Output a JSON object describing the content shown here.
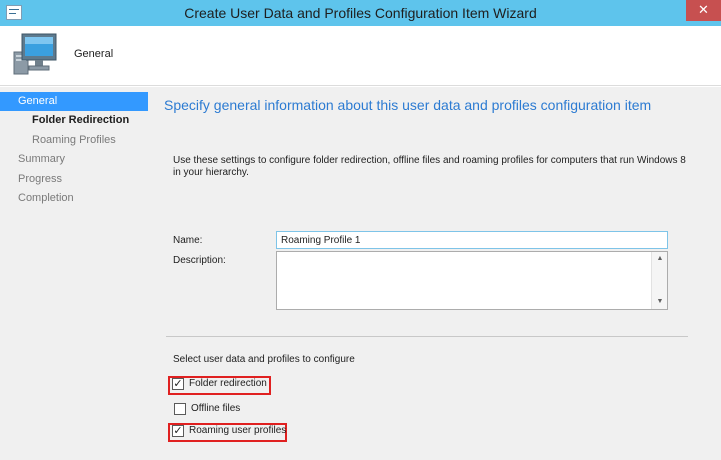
{
  "window": {
    "title": "Create User Data and Profiles Configuration Item Wizard",
    "close_glyph": "✕"
  },
  "header": {
    "title": "General"
  },
  "sidebar": {
    "items": [
      {
        "label": "General"
      },
      {
        "label": "Folder Redirection"
      },
      {
        "label": "Roaming Profiles"
      },
      {
        "label": "Summary"
      },
      {
        "label": "Progress"
      },
      {
        "label": "Completion"
      }
    ]
  },
  "main": {
    "heading": "Specify general information about this user data and profiles configuration item",
    "description": "Use these settings to configure folder redirection, offline files and roaming profiles for computers that run Windows 8 in your hierarchy.",
    "name_label": "Name:",
    "name_value": "Roaming Profile 1",
    "description_label": "Description:",
    "description_value": "",
    "select_label": "Select user data and profiles to configure",
    "checkboxes": [
      {
        "label": "Folder redirection",
        "checked": true,
        "check_glyph": "✓"
      },
      {
        "label": "Offline files",
        "checked": false,
        "check_glyph": ""
      },
      {
        "label": "Roaming user profiles",
        "checked": true,
        "check_glyph": "✓"
      }
    ]
  },
  "icons": {
    "system_menu": "window-menu-icon",
    "header": "computer-monitor-icon",
    "scroll_up": "▲",
    "scroll_down": "▼"
  },
  "colors": {
    "titlebar": "#5ec4ec",
    "close_button": "#c75050",
    "nav_active": "#3399ff",
    "heading": "#2c7bd2",
    "highlight_box": "#e02020"
  }
}
